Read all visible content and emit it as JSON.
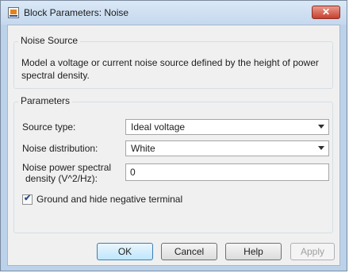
{
  "window": {
    "title": "Block Parameters: Noise",
    "close_symbol": "✕"
  },
  "noise_source": {
    "group_title": "Noise Source",
    "description": "Model a voltage or current noise source defined by the height of power spectral density."
  },
  "parameters": {
    "group_title": "Parameters",
    "source_type": {
      "label": "Source type:",
      "value": "Ideal voltage"
    },
    "noise_distribution": {
      "label": "Noise distribution:",
      "value": "White"
    },
    "noise_power": {
      "label_line1": "Noise power spectral",
      "label_line2": "density (V^2/Hz):",
      "value": "0"
    },
    "ground_checkbox": {
      "label": "Ground and hide negative terminal",
      "checked": true
    }
  },
  "buttons": {
    "ok": "OK",
    "cancel": "Cancel",
    "help": "Help",
    "apply": "Apply"
  },
  "icons": {
    "app": "simulink-block-icon",
    "close": "close-icon",
    "dropdown": "chevron-down-icon",
    "check": "checkmark-icon"
  }
}
